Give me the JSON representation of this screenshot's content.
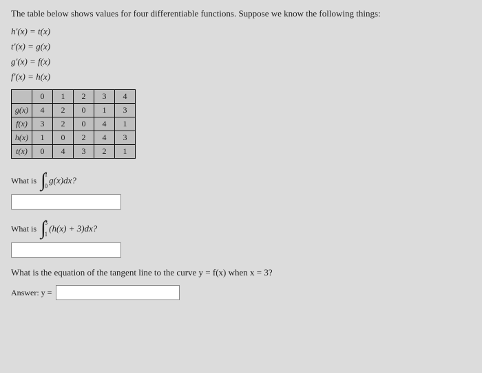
{
  "intro": "The table below shows values for four differentiable functions. Suppose we know the following things:",
  "eqns": {
    "e1": "h′(x) = t(x)",
    "e2": "t′(x) = g(x)",
    "e3": "g′(x) = f(x)",
    "e4": "f′(x) = h(x)"
  },
  "chart_data": {
    "type": "table",
    "title": "",
    "columns": [
      "",
      "0",
      "1",
      "2",
      "3",
      "4"
    ],
    "rows": [
      {
        "fn": "g(x)",
        "vals": [
          "4",
          "2",
          "0",
          "1",
          "3"
        ]
      },
      {
        "fn": "f(x)",
        "vals": [
          "3",
          "2",
          "0",
          "4",
          "1"
        ]
      },
      {
        "fn": "h(x)",
        "vals": [
          "1",
          "0",
          "2",
          "4",
          "3"
        ]
      },
      {
        "fn": "t(x)",
        "vals": [
          "0",
          "4",
          "3",
          "2",
          "1"
        ]
      }
    ]
  },
  "q1": {
    "prefix": "What is",
    "lower": "0",
    "upper": "1",
    "body": "g(x)dx?"
  },
  "q2": {
    "prefix": "What is",
    "lower": "1",
    "upper": "3",
    "body": "(h(x) + 3)dx?"
  },
  "q3": {
    "text": "What is the equation of the tangent line to the curve y = f(x) when x = 3?",
    "answer_label": "Answer: y ="
  }
}
